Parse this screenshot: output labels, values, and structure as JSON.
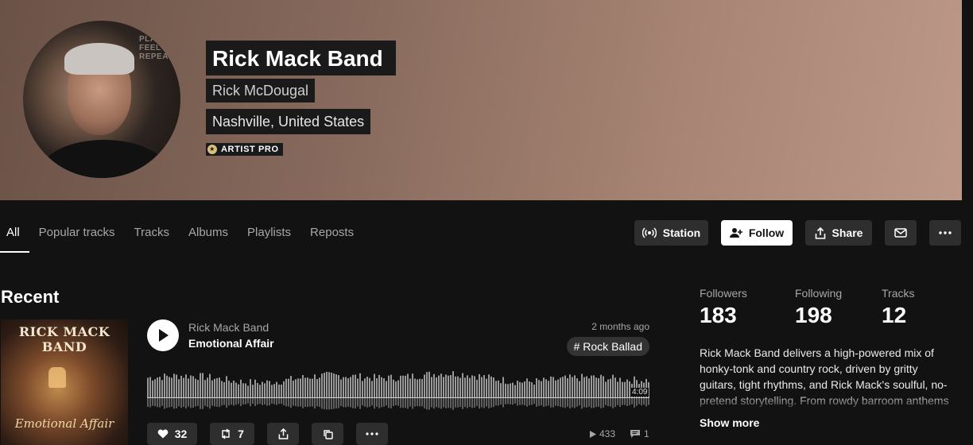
{
  "profile": {
    "band_name": "Rick Mack Band",
    "real_name": "Rick McDougal",
    "location": "Nashville, United States",
    "badge": "ARTIST PRO",
    "avatar_sign": "PLAY FEEL REPEAT"
  },
  "tabs": [
    {
      "label": "All",
      "active": true
    },
    {
      "label": "Popular tracks"
    },
    {
      "label": "Tracks"
    },
    {
      "label": "Albums"
    },
    {
      "label": "Playlists"
    },
    {
      "label": "Reposts"
    }
  ],
  "actions": {
    "station": "Station",
    "follow": "Follow",
    "share": "Share"
  },
  "recent": {
    "title": "Recent",
    "track": {
      "cover_title": "RICK MACK BAND",
      "cover_subtitle": "Emotional Affair",
      "artist": "Rick Mack Band",
      "title": "Emotional Affair",
      "posted": "2 months ago",
      "genre": "# Rock Ballad",
      "duration": "4:09",
      "likes": "32",
      "reposts": "7",
      "plays": "433",
      "comments": "1"
    }
  },
  "stats": {
    "followers_label": "Followers",
    "followers": "183",
    "following_label": "Following",
    "following": "198",
    "tracks_label": "Tracks",
    "tracks": "12"
  },
  "bio": {
    "text": "Rick Mack Band delivers a high-powered mix of honky-tonk and country rock, driven by gritty guitars, tight rhythms, and Rick Mack's soulful, no-pretend storytelling. From rowdy barroom anthems",
    "show_more": "Show more"
  },
  "colors": {
    "background": "#121212",
    "button": "#2e2e2e",
    "banner_start": "#6b5247",
    "banner_end": "#bb9888",
    "badge_gold": "#d8c07a"
  }
}
